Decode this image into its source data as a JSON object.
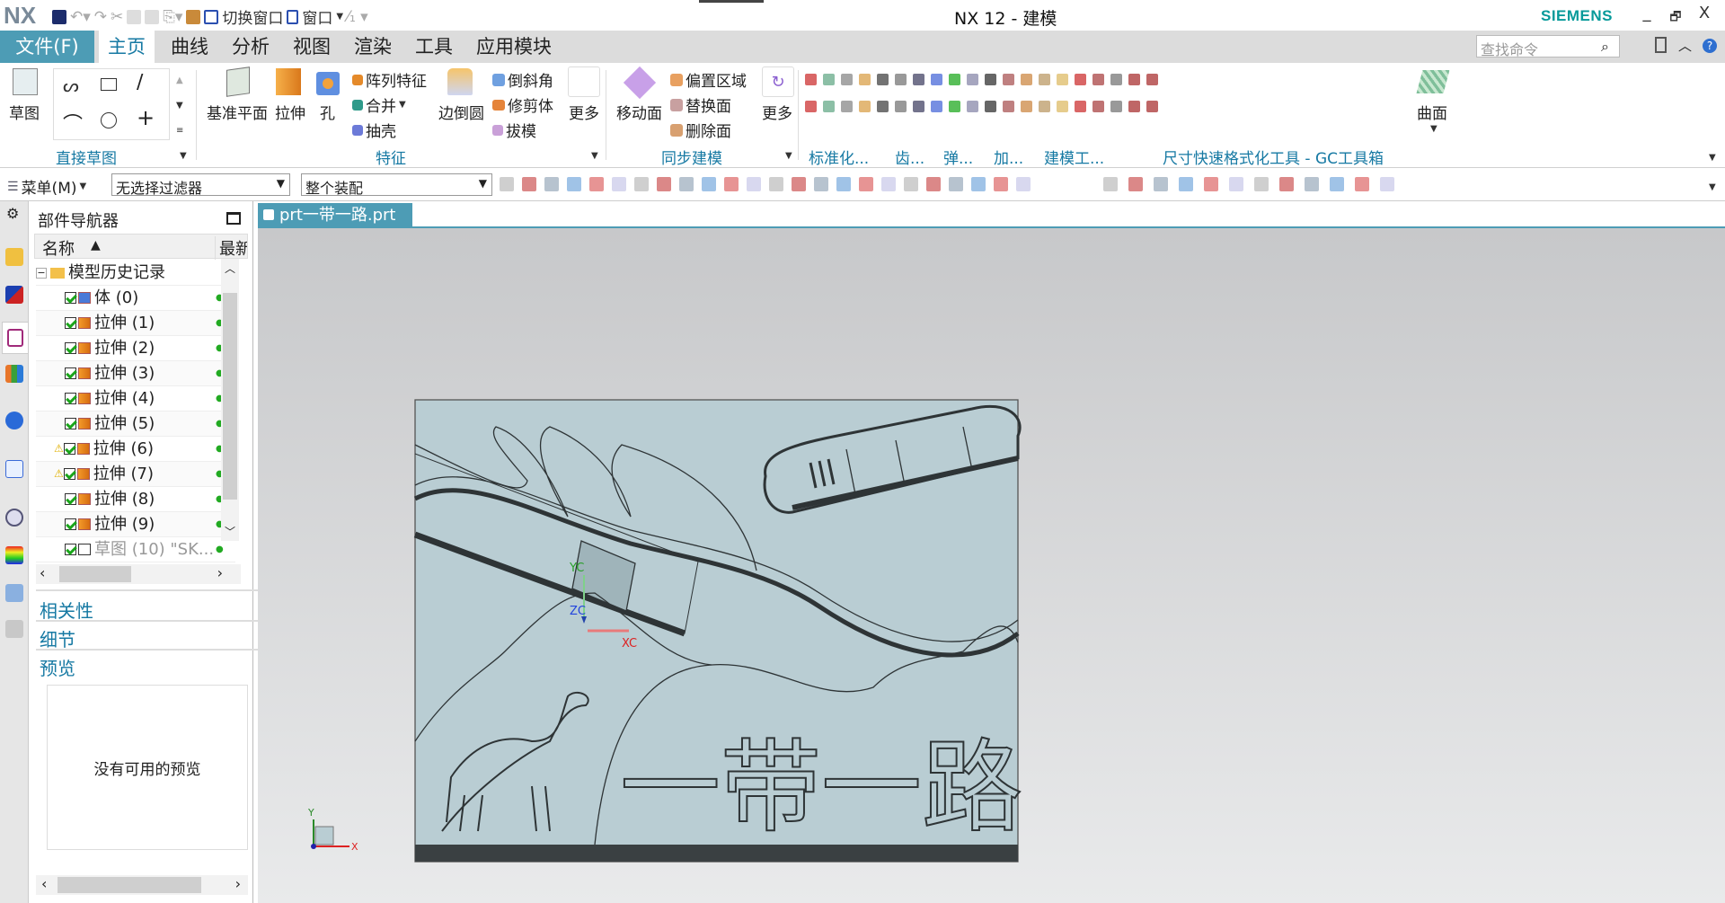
{
  "titlebar": {
    "logo": "NX",
    "title": "NX 12 - 建模",
    "brand": "SIEMENS",
    "switch_window": "切换窗口",
    "window": "窗口",
    "min": "_",
    "restore": "🗗",
    "close": "X"
  },
  "menubar": {
    "file": "文件(F)",
    "tabs": [
      "主页",
      "曲线",
      "分析",
      "视图",
      "渲染",
      "工具",
      "应用模块"
    ],
    "active": "主页",
    "search_placeholder": "查找命令"
  },
  "ribbon": {
    "sketch": "草图",
    "groups": [
      "直接草图",
      "特征",
      "同步建模",
      "标准化...",
      "齿...",
      "弹...",
      "加...",
      "建模工...",
      "尺寸快速格式化工具 - GC工具箱"
    ],
    "feature": {
      "datum_plane": "基准平面",
      "extrude": "拉伸",
      "hole": "孔",
      "pattern": "阵列特征",
      "unite": "合并",
      "shell": "抽壳",
      "edge_blend": "边倒圆",
      "chamfer": "倒斜角",
      "trim_body": "修剪体",
      "draft": "拔模",
      "more": "更多"
    },
    "sync": {
      "move_face": "移动面",
      "offset_region": "偏置区域",
      "replace_face": "替换面",
      "delete_face": "删除面",
      "more": "更多"
    },
    "surface": "曲面"
  },
  "toolbar": {
    "menu": "菜单(M)",
    "filter": "无选择过滤器",
    "scope": "整个装配"
  },
  "document_tab": {
    "label": "prt一带一路.prt",
    "close": "×"
  },
  "navigator": {
    "title": "部件导航器",
    "columns": [
      "名称",
      "最新"
    ],
    "root": "模型历史记录",
    "items": [
      {
        "label": "体 (0)",
        "warning": false
      },
      {
        "label": "拉伸 (1)",
        "warning": false
      },
      {
        "label": "拉伸 (2)",
        "warning": false
      },
      {
        "label": "拉伸 (3)",
        "warning": false
      },
      {
        "label": "拉伸 (4)",
        "warning": false
      },
      {
        "label": "拉伸 (5)",
        "warning": false
      },
      {
        "label": "拉伸 (6)",
        "warning": true
      },
      {
        "label": "拉伸 (7)",
        "warning": true
      },
      {
        "label": "拉伸 (8)",
        "warning": false
      },
      {
        "label": "拉伸 (9)",
        "warning": false
      },
      {
        "label": "草图 (10) \"SK...",
        "warning": false
      }
    ],
    "sections": [
      "相关性",
      "细节",
      "预览"
    ],
    "preview_empty": "没有可用的预览"
  },
  "viewport": {
    "axes": {
      "x": "XC",
      "y": "YC",
      "z": "ZC"
    },
    "triad": {
      "x": "X",
      "y": "Y"
    },
    "model_text": "一带一路"
  },
  "colors": {
    "accent": "#4d9cb5",
    "link": "#1679a3",
    "model": "#b9cdd3",
    "model_shadow": "#3a4042"
  }
}
